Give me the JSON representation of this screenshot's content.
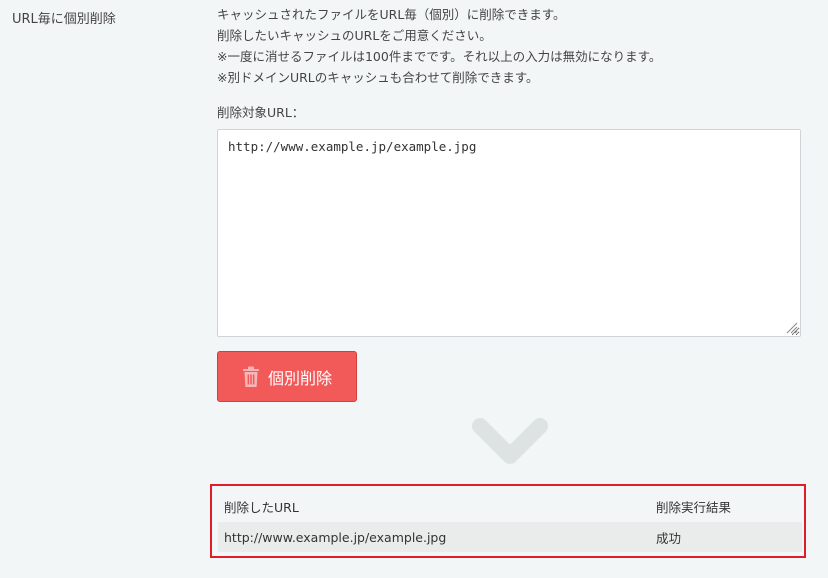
{
  "section": {
    "label": "URL毎に個別削除"
  },
  "description": {
    "lines": [
      "キャッシュされたファイルをURL毎（個別）に削除できます。",
      "削除したいキャッシュのURLをご用意ください。",
      "※一度に消せるファイルは100件までです。それ以上の入力は無効になります。",
      "※別ドメインURLのキャッシュも合わせて削除できます。"
    ]
  },
  "form": {
    "field_label": "削除対象URL：",
    "textarea_value": "http://www.example.jp/example.jpg",
    "delete_button_label": "個別削除"
  },
  "result": {
    "headers": [
      "削除したURL",
      "削除実行結果"
    ],
    "rows": [
      [
        "http://www.example.jp/example.jpg",
        "成功"
      ]
    ]
  },
  "colors": {
    "button": "#f25a5a",
    "result_border": "#dd1e2a",
    "arrow": "#dde2e3",
    "background": "#f3f6f7"
  },
  "icons": {
    "button": "trash-icon",
    "flow": "chevron-down-icon"
  }
}
